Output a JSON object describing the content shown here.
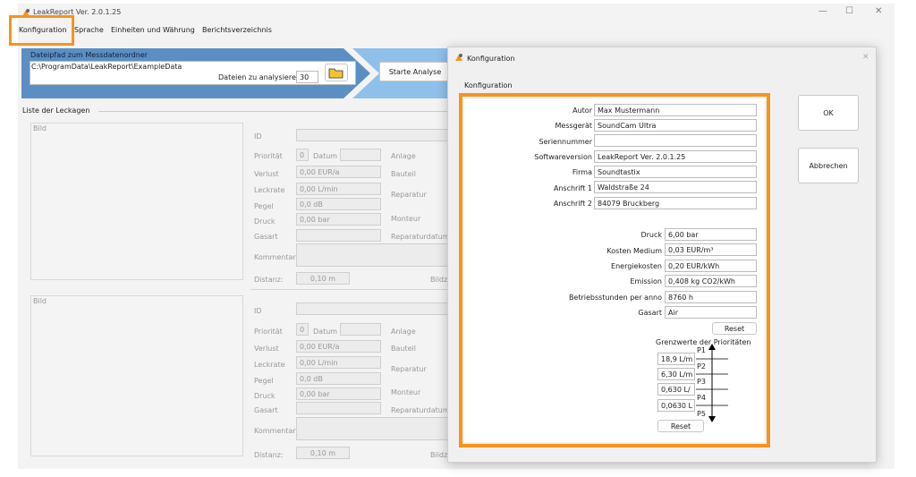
{
  "window": {
    "title": "LeakReport Ver. 2.0.1.25",
    "min": "—",
    "max": "☐",
    "close": "✕"
  },
  "menu": [
    "Konfiguration",
    "Sprache",
    "Einheiten und Währung",
    "Berichtsverzeichnis"
  ],
  "banner": {
    "path_label": "Dateipfad zum Messdatenordner",
    "path_value": "C:\\ProgramData\\LeakReport\\ExampleData",
    "files_label": "Dateien zu analysieren",
    "files_value": "30",
    "start": "Starte Analyse"
  },
  "list": {
    "title": "Liste der Leckagen",
    "bild": "Bild",
    "id": "ID",
    "prioritaet": "Priorität",
    "prio_value": "0",
    "datum": "Datum",
    "anlage": "Anlage",
    "verlust": "Verlust",
    "verlust_value": "0,00 EUR/a",
    "bauteil": "Bauteil",
    "leckrate": "Leckrate",
    "leckrate_value": "0,00 L/min",
    "reparatur": "Reparatur",
    "pegel": "Pegel",
    "pegel_value": "0,0 dB",
    "druck": "Druck",
    "druck_value": "0,00 bar",
    "monteur": "Monteur",
    "gasart": "Gasart",
    "reparaturdatum": "Reparaturdatum",
    "kommentar": "Kommentar",
    "distanz": "Distanz:",
    "distanz_value": "0,10 m",
    "bildz": "Bildz"
  },
  "dialog": {
    "title": "Konfiguration",
    "group": "Konfiguration",
    "close": "✕",
    "fields1": [
      {
        "label": "Autor",
        "value": "Max Mustermann"
      },
      {
        "label": "Messgerät",
        "value": "SoundCam Ultra"
      },
      {
        "label": "Seriennummer",
        "value": ""
      },
      {
        "label": "Softwareversion",
        "value": "LeakReport Ver. 2.0.1.25"
      },
      {
        "label": "Firma",
        "value": "Soundtastix"
      },
      {
        "label": "Anschrift 1",
        "value": "Waldstraße 24"
      },
      {
        "label": "Anschrift 2",
        "value": "84079 Bruckberg"
      }
    ],
    "fields2": [
      {
        "label": "Druck",
        "value": "6,00 bar"
      },
      {
        "label": "Kosten Medium",
        "value": "0,03 EUR/m³"
      },
      {
        "label": "Energiekosten",
        "value": "0,20 EUR/kWh"
      },
      {
        "label": "Emission",
        "value": "0,408 kg CO2/kWh"
      },
      {
        "label": "Betriebsstunden per anno",
        "value": "8760 h"
      },
      {
        "label": "Gasart",
        "value": "Air"
      }
    ],
    "reset": "Reset",
    "grenz_title": "Grenzwerte der Prioritäten",
    "grenz_values": [
      "18,9 L/m",
      "6,30 L/m",
      "0,630 L/",
      "0,0630 L"
    ],
    "prios": [
      "P1",
      "P2",
      "P3",
      "P4",
      "P5"
    ],
    "ok": "OK",
    "cancel": "Abbrechen"
  }
}
